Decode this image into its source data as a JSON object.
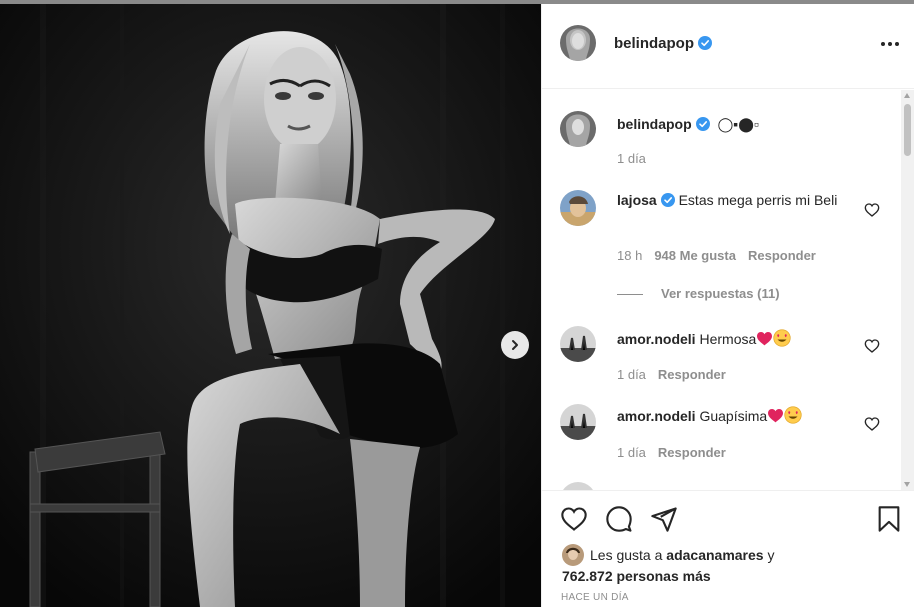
{
  "post": {
    "username": "belindapop",
    "caption_symbols": "◯▪⬤▫",
    "caption_time": "1 día"
  },
  "comments": [
    {
      "username": "lajosa",
      "text": "Estas mega perris mi Beli",
      "time": "18 h",
      "likes": "948 Me gusta",
      "reply_label": "Responder",
      "view_replies": "Ver respuestas (11)"
    },
    {
      "username": "amor.nodeli",
      "text": "Hermosa",
      "time": "1 día",
      "reply_label": "Responder"
    },
    {
      "username": "amor.nodeli",
      "text": "Guapísima",
      "time": "1 día",
      "reply_label": "Responder"
    }
  ],
  "likes": {
    "prefix": "Les gusta a",
    "user": "adacanamares",
    "connector": "y",
    "count": "762.872 personas más"
  },
  "time_ago": "HACE UN DÍA",
  "icons": [
    "verified-badge-icon",
    "more-options-icon",
    "heart-icon",
    "comment-icon",
    "share-icon",
    "bookmark-icon",
    "chevron-right-icon"
  ],
  "colors": {
    "verified": "#3897f0",
    "text": "#262626",
    "muted": "#8e8e8e",
    "heart_emoji": "#e0245e"
  }
}
